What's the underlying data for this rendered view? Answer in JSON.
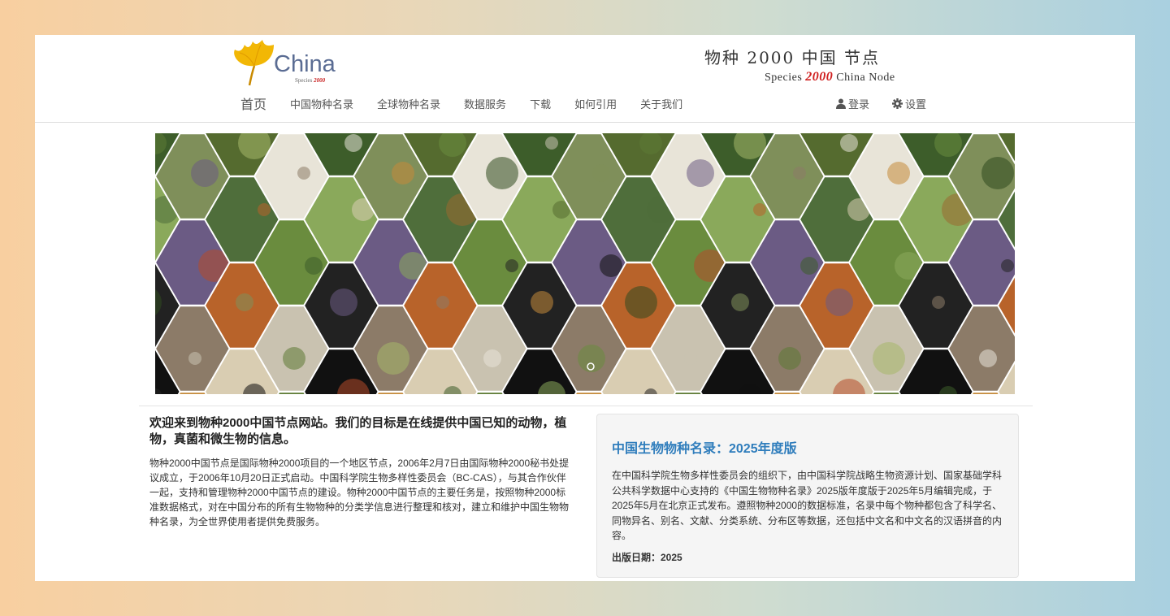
{
  "header": {
    "logo_text": "China",
    "logo_sub_prefix": "Species",
    "logo_sub_year": "2000",
    "brand_cn": "物种 2000 中国 节点",
    "brand_en_prefix": "Species",
    "brand_en_year": "2000",
    "brand_en_suffix": "China Node"
  },
  "nav": {
    "items": [
      "首页",
      "中国物种名录",
      "全球物种名录",
      "数据服务",
      "下载",
      "如何引用",
      "关于我们"
    ],
    "login_label": "登录",
    "settings_label": "设置"
  },
  "banner": {
    "alt": "Hexagon collage of species photos",
    "carousel_indicators": 1
  },
  "intro": {
    "heading": "欢迎来到物种2000中国节点网站。我们的目标是在线提供中国已知的动物，植物，真菌和微生物的信息。",
    "body": "物种2000中国节点是国际物种2000项目的一个地区节点，2006年2月7日由国际物种2000秘书处提议成立，于2006年10月20日正式启动。中国科学院生物多样性委员会（BC-CAS），与其合作伙伴一起，支持和管理物种2000中国节点的建设。物种2000中国节点的主要任务是，按照物种2000标准数据格式，对在中国分布的所有生物物种的分类学信息进行整理和核对，建立和维护中国生物物种名录，为全世界使用者提供免费服务。"
  },
  "panel": {
    "title": "中国生物物种名录：2025年度版",
    "body": "在中国科学院生物多样性委员会的组织下，由中国科学院战略生物资源计划、国家基础学科公共科学数据中心支持的《中国生物物种名录》2025版年度版于2025年5月编辑完成，于2025年5月在北京正式发布。遵照物种2000的数据标准，名录中每个物种都包含了科学名、同物异名、别名、文献、分类系统、分布区等数据，还包括中文名和中文名的汉语拼音的内容。",
    "date_label": "出版日期：2025"
  },
  "colors": {
    "link_blue": "#2f7dbc",
    "logo_blue": "#5a6c93",
    "ginkgo_yellow": "#f2b705",
    "accent_red": "#d02020"
  }
}
